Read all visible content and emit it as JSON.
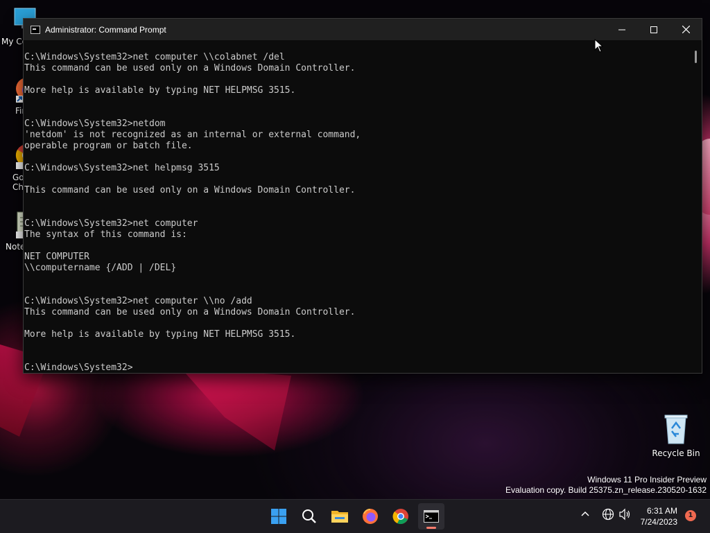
{
  "window": {
    "title": "Administrator: Command Prompt",
    "console_lines": [
      "C:\\Windows\\System32>net computer \\\\colabnet /del",
      "This command can be used only on a Windows Domain Controller.",
      "",
      "More help is available by typing NET HELPMSG 3515.",
      "",
      "",
      "C:\\Windows\\System32>netdom",
      "'netdom' is not recognized as an internal or external command,",
      "operable program or batch file.",
      "",
      "C:\\Windows\\System32>net helpmsg 3515",
      "",
      "This command can be used only on a Windows Domain Controller.",
      "",
      "",
      "C:\\Windows\\System32>net computer",
      "The syntax of this command is:",
      "",
      "NET COMPUTER",
      "\\\\computername {/ADD | /DEL}",
      "",
      "",
      "C:\\Windows\\System32>net computer \\\\no /add",
      "This command can be used only on a Windows Domain Controller.",
      "",
      "More help is available by typing NET HELPMSG 3515.",
      "",
      "",
      "C:\\Windows\\System32>"
    ]
  },
  "desktop": {
    "icons": [
      {
        "label": "My Co",
        "icon": "computer-icon"
      },
      {
        "label": "Fir",
        "icon": "firefox-icon"
      },
      {
        "label": "Go\nCh",
        "icon": "chrome-icon"
      },
      {
        "label": "Note",
        "icon": "notepad-icon"
      },
      {
        "label": "Recycle Bin",
        "icon": "recycle-bin-icon"
      }
    ],
    "watermark_line1": "Windows 11 Pro Insider Preview",
    "watermark_line2": "Evaluation copy. Build 25375.zn_release.230520-1632"
  },
  "taskbar": {
    "apps": [
      {
        "name": "start",
        "icon": "windows-start-icon"
      },
      {
        "name": "search",
        "icon": "search-icon"
      },
      {
        "name": "file-explorer",
        "icon": "folder-icon"
      },
      {
        "name": "firefox",
        "icon": "firefox-icon"
      },
      {
        "name": "chrome",
        "icon": "chrome-icon"
      },
      {
        "name": "command-prompt",
        "icon": "terminal-icon"
      }
    ],
    "clock_time": "6:31 AM",
    "clock_date": "7/24/2023",
    "notification_count": "1"
  },
  "colors": {
    "console_bg": "#0c0c0c",
    "console_text": "#cccccc",
    "titlebar_bg": "#202020",
    "taskbar_bg": "#1c1b20",
    "accent_indicator": "#ff7d6e"
  }
}
